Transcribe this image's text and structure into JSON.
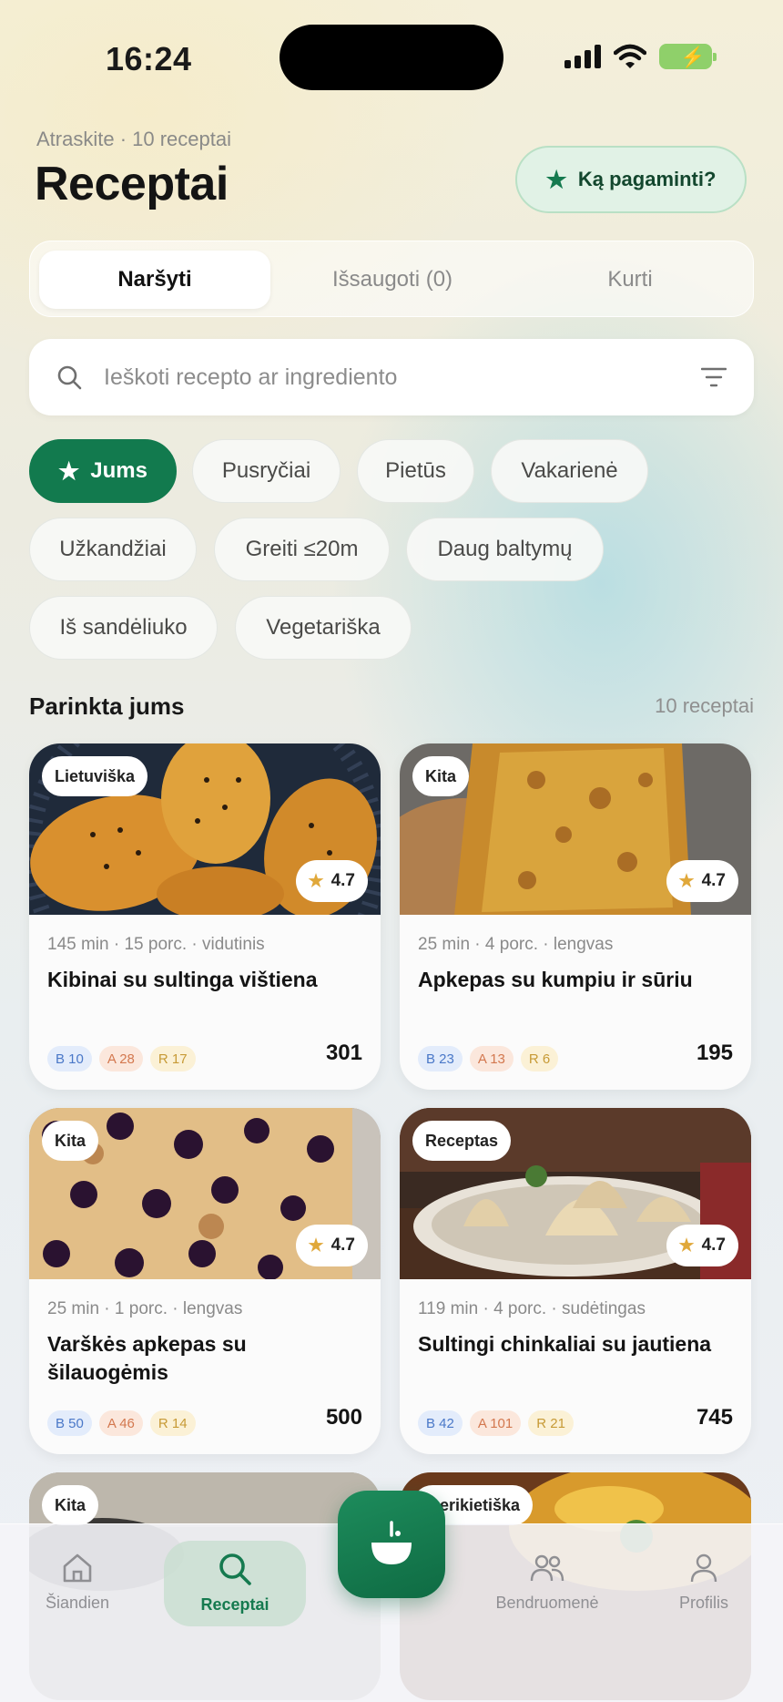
{
  "status": {
    "time": "16:24"
  },
  "header": {
    "subtitle": "Atraskite · 10 receptai",
    "title": "Receptai",
    "suggest_label": "Ką pagaminti?"
  },
  "tabs": [
    {
      "label": "Naršyti",
      "active": true
    },
    {
      "label": "Išsaugoti (0)",
      "active": false
    },
    {
      "label": "Kurti",
      "active": false
    }
  ],
  "search": {
    "placeholder": "Ieškoti recepto ar ingrediento"
  },
  "chips": [
    {
      "label": "Jums",
      "active": true
    },
    {
      "label": "Pusryčiai"
    },
    {
      "label": "Pietūs"
    },
    {
      "label": "Vakarienė"
    },
    {
      "label": "Užkandžiai"
    },
    {
      "label": "Greiti ≤20m"
    },
    {
      "label": "Daug baltymų"
    },
    {
      "label": "Iš sandėliuko"
    },
    {
      "label": "Vegetariška"
    }
  ],
  "section": {
    "title": "Parinkta jums",
    "count": "10 receptai"
  },
  "recipes": [
    {
      "tag": "Lietuviška",
      "rating": "4.7",
      "meta": "145 min · 15 porc. · vidutinis",
      "name": "Kibinai su sultinga vištiena",
      "protein": "B 10",
      "fat": "A 28",
      "carbs": "R 17",
      "kcal": "301"
    },
    {
      "tag": "Kita",
      "rating": "4.7",
      "meta": "25 min · 4 porc. · lengvas",
      "name": "Apkepas su kumpiu ir sūriu",
      "protein": "B 23",
      "fat": "A 13",
      "carbs": "R 6",
      "kcal": "195"
    },
    {
      "tag": "Kita",
      "rating": "4.7",
      "meta": "25 min · 1 porc. · lengvas",
      "name": "Varškės apkepas su šilauogėmis",
      "protein": "B 50",
      "fat": "A 46",
      "carbs": "R 14",
      "kcal": "500"
    },
    {
      "tag": "Receptas",
      "rating": "4.7",
      "meta": "119 min · 4 porc. · sudėtingas",
      "name": "Sultingi chinkaliai su jautiena",
      "protein": "B 42",
      "fat": "A 101",
      "carbs": "R 21",
      "kcal": "745"
    }
  ],
  "peek": [
    {
      "tag": "Kita"
    },
    {
      "tag": "merikietiška"
    }
  ],
  "nav": [
    {
      "label": "Šiandien",
      "icon": "home-icon"
    },
    {
      "label": "Receptai",
      "icon": "search-icon",
      "active": true
    },
    {
      "label": "Bendruomenė",
      "icon": "people-icon"
    },
    {
      "label": "Profilis",
      "icon": "person-icon"
    }
  ],
  "colors": {
    "accent": "#127a4e",
    "accent_light": "#e1f2e6",
    "star": "#e0a83a"
  }
}
